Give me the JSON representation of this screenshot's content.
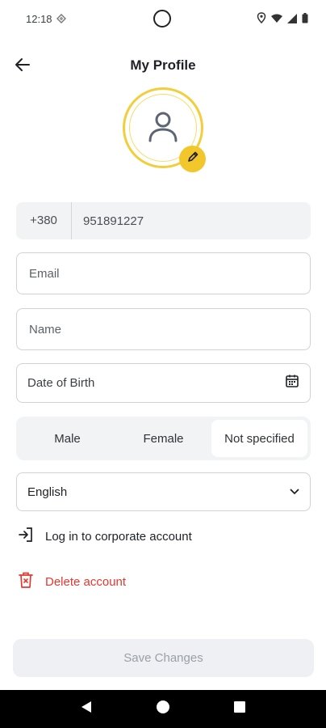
{
  "status_bar": {
    "time": "12:18",
    "icons": [
      "location-icon",
      "wifi-icon",
      "signal-icon",
      "battery-icon"
    ]
  },
  "header": {
    "title": "My Profile",
    "back_icon": "arrow-left-icon"
  },
  "avatar": {
    "icon": "user-icon",
    "edit_icon": "pencil-icon",
    "accent_color": "#f2c72b"
  },
  "form": {
    "phone": {
      "prefix": "+380",
      "number": "951891227"
    },
    "email": {
      "placeholder": "Email",
      "value": ""
    },
    "name": {
      "placeholder": "Name",
      "value": ""
    },
    "date_of_birth": {
      "label": "Date of Birth",
      "icon": "calendar-icon"
    },
    "gender": {
      "options": [
        "Male",
        "Female",
        "Not specified"
      ],
      "selected": "Not specified"
    },
    "language": {
      "value": "English",
      "icon": "chevron-down-icon"
    }
  },
  "links": {
    "corporate": {
      "label": "Log in to corporate account",
      "icon": "login-icon"
    },
    "delete": {
      "label": "Delete account",
      "icon": "trash-icon",
      "color": "#e5392f"
    }
  },
  "save_button": {
    "label": "Save Changes",
    "enabled": false
  },
  "nav_bar": {
    "buttons": [
      "back-triangle-icon",
      "home-circle-icon",
      "recents-square-icon"
    ]
  }
}
